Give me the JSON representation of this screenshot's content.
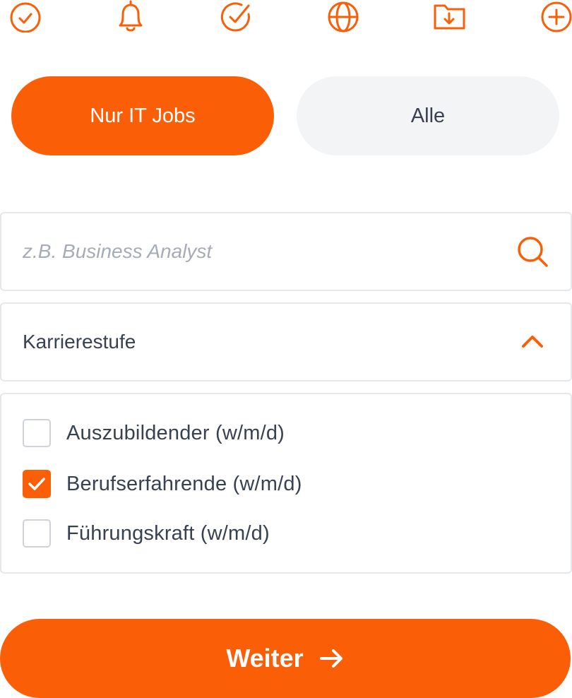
{
  "colors": {
    "accent": "#fa5f08",
    "text": "#374151",
    "placeholder": "#a6acb7",
    "inactive_bg": "#f3f4f6",
    "border": "#e5e7eb"
  },
  "top_icons": [
    "check-circle-icon",
    "bell-icon",
    "check-badge-icon",
    "globe-icon",
    "folder-download-icon",
    "plus-circle-icon"
  ],
  "job_filter": {
    "active_label": "Nur IT Jobs",
    "inactive_label": "Alle"
  },
  "search": {
    "placeholder": "z.B. Business Analyst",
    "value": "",
    "icon": "search-icon"
  },
  "career_level": {
    "label": "Karrierestufe",
    "expanded": true,
    "options": [
      {
        "label": "Auszubildender (w/m/d)",
        "checked": false
      },
      {
        "label": "Berufserfahrende (w/m/d)",
        "checked": true
      },
      {
        "label": "Führungskraft (w/m/d)",
        "checked": false
      }
    ]
  },
  "next_button": {
    "label": "Weiter",
    "icon": "arrow-right-icon"
  }
}
